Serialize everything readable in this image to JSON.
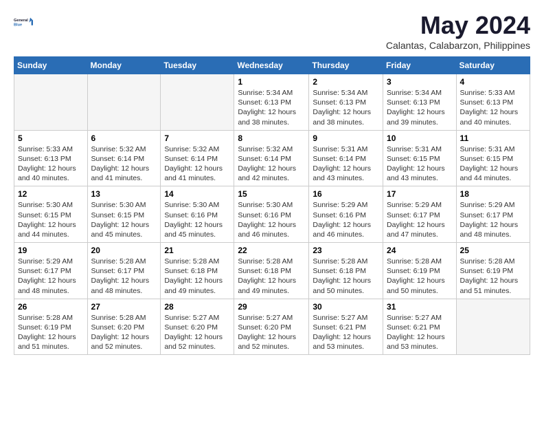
{
  "logo": {
    "line1": "General",
    "line2": "Blue"
  },
  "title": "May 2024",
  "subtitle": "Calantas, Calabarzon, Philippines",
  "weekdays": [
    "Sunday",
    "Monday",
    "Tuesday",
    "Wednesday",
    "Thursday",
    "Friday",
    "Saturday"
  ],
  "weeks": [
    [
      {
        "day": "",
        "info": ""
      },
      {
        "day": "",
        "info": ""
      },
      {
        "day": "",
        "info": ""
      },
      {
        "day": "1",
        "info": "Sunrise: 5:34 AM\nSunset: 6:13 PM\nDaylight: 12 hours\nand 38 minutes."
      },
      {
        "day": "2",
        "info": "Sunrise: 5:34 AM\nSunset: 6:13 PM\nDaylight: 12 hours\nand 38 minutes."
      },
      {
        "day": "3",
        "info": "Sunrise: 5:34 AM\nSunset: 6:13 PM\nDaylight: 12 hours\nand 39 minutes."
      },
      {
        "day": "4",
        "info": "Sunrise: 5:33 AM\nSunset: 6:13 PM\nDaylight: 12 hours\nand 40 minutes."
      }
    ],
    [
      {
        "day": "5",
        "info": "Sunrise: 5:33 AM\nSunset: 6:13 PM\nDaylight: 12 hours\nand 40 minutes."
      },
      {
        "day": "6",
        "info": "Sunrise: 5:32 AM\nSunset: 6:14 PM\nDaylight: 12 hours\nand 41 minutes."
      },
      {
        "day": "7",
        "info": "Sunrise: 5:32 AM\nSunset: 6:14 PM\nDaylight: 12 hours\nand 41 minutes."
      },
      {
        "day": "8",
        "info": "Sunrise: 5:32 AM\nSunset: 6:14 PM\nDaylight: 12 hours\nand 42 minutes."
      },
      {
        "day": "9",
        "info": "Sunrise: 5:31 AM\nSunset: 6:14 PM\nDaylight: 12 hours\nand 43 minutes."
      },
      {
        "day": "10",
        "info": "Sunrise: 5:31 AM\nSunset: 6:15 PM\nDaylight: 12 hours\nand 43 minutes."
      },
      {
        "day": "11",
        "info": "Sunrise: 5:31 AM\nSunset: 6:15 PM\nDaylight: 12 hours\nand 44 minutes."
      }
    ],
    [
      {
        "day": "12",
        "info": "Sunrise: 5:30 AM\nSunset: 6:15 PM\nDaylight: 12 hours\nand 44 minutes."
      },
      {
        "day": "13",
        "info": "Sunrise: 5:30 AM\nSunset: 6:15 PM\nDaylight: 12 hours\nand 45 minutes."
      },
      {
        "day": "14",
        "info": "Sunrise: 5:30 AM\nSunset: 6:16 PM\nDaylight: 12 hours\nand 45 minutes."
      },
      {
        "day": "15",
        "info": "Sunrise: 5:30 AM\nSunset: 6:16 PM\nDaylight: 12 hours\nand 46 minutes."
      },
      {
        "day": "16",
        "info": "Sunrise: 5:29 AM\nSunset: 6:16 PM\nDaylight: 12 hours\nand 46 minutes."
      },
      {
        "day": "17",
        "info": "Sunrise: 5:29 AM\nSunset: 6:17 PM\nDaylight: 12 hours\nand 47 minutes."
      },
      {
        "day": "18",
        "info": "Sunrise: 5:29 AM\nSunset: 6:17 PM\nDaylight: 12 hours\nand 48 minutes."
      }
    ],
    [
      {
        "day": "19",
        "info": "Sunrise: 5:29 AM\nSunset: 6:17 PM\nDaylight: 12 hours\nand 48 minutes."
      },
      {
        "day": "20",
        "info": "Sunrise: 5:28 AM\nSunset: 6:17 PM\nDaylight: 12 hours\nand 48 minutes."
      },
      {
        "day": "21",
        "info": "Sunrise: 5:28 AM\nSunset: 6:18 PM\nDaylight: 12 hours\nand 49 minutes."
      },
      {
        "day": "22",
        "info": "Sunrise: 5:28 AM\nSunset: 6:18 PM\nDaylight: 12 hours\nand 49 minutes."
      },
      {
        "day": "23",
        "info": "Sunrise: 5:28 AM\nSunset: 6:18 PM\nDaylight: 12 hours\nand 50 minutes."
      },
      {
        "day": "24",
        "info": "Sunrise: 5:28 AM\nSunset: 6:19 PM\nDaylight: 12 hours\nand 50 minutes."
      },
      {
        "day": "25",
        "info": "Sunrise: 5:28 AM\nSunset: 6:19 PM\nDaylight: 12 hours\nand 51 minutes."
      }
    ],
    [
      {
        "day": "26",
        "info": "Sunrise: 5:28 AM\nSunset: 6:19 PM\nDaylight: 12 hours\nand 51 minutes."
      },
      {
        "day": "27",
        "info": "Sunrise: 5:28 AM\nSunset: 6:20 PM\nDaylight: 12 hours\nand 52 minutes."
      },
      {
        "day": "28",
        "info": "Sunrise: 5:27 AM\nSunset: 6:20 PM\nDaylight: 12 hours\nand 52 minutes."
      },
      {
        "day": "29",
        "info": "Sunrise: 5:27 AM\nSunset: 6:20 PM\nDaylight: 12 hours\nand 52 minutes."
      },
      {
        "day": "30",
        "info": "Sunrise: 5:27 AM\nSunset: 6:21 PM\nDaylight: 12 hours\nand 53 minutes."
      },
      {
        "day": "31",
        "info": "Sunrise: 5:27 AM\nSunset: 6:21 PM\nDaylight: 12 hours\nand 53 minutes."
      },
      {
        "day": "",
        "info": ""
      }
    ]
  ]
}
